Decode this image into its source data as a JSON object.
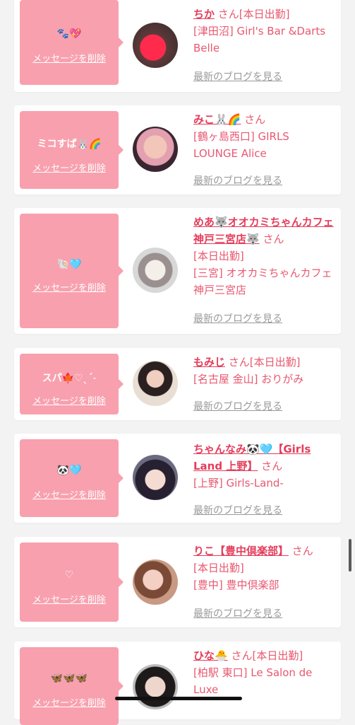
{
  "common": {
    "delete_label": "メッセージを削除",
    "blog_label": "最新のブログを見る",
    "san": "さん"
  },
  "cards": [
    {
      "msg": "🐾💖",
      "name": "ちか",
      "lines": [
        "さん[本日出勤]",
        "[津田沼] Girl's Bar &Darts Belle"
      ]
    },
    {
      "msg": "ミコすぱ🐰🌈",
      "name": "みこ🐰🌈",
      "lines": [
        "[鶴ヶ島西口] GIRLS LOUNGE Alice"
      ]
    },
    {
      "msg": "🐚🩵",
      "name": "めあ🐺オオカミちゃんカフェ神戸三宮店🐺",
      "lines": [
        "[本日出勤]",
        "[三宮] オオカミちゃんカフェ神戸三宮店"
      ]
    },
    {
      "msg": "スパ🍁♡ˎˊ˗",
      "name": "もみじ",
      "lines": [
        "さん[本日出勤]",
        "[名古屋 金山] おりがみ"
      ]
    },
    {
      "msg": "🐼🩵",
      "name": "ちゃんなみ🐼🩵【Girls Land 上野】",
      "lines": [
        "[上野] Girls-Land-"
      ]
    },
    {
      "msg": "♡",
      "name": "りこ【豊中倶楽部】",
      "lines": [
        "[本日出勤]",
        "[豊中] 豊中倶楽部"
      ]
    },
    {
      "msg": "🦋🦋🦋",
      "name": "ひな🐣",
      "lines": [
        "さん[本日出勤]",
        "[柏駅 東口] Le Salon de Luxe"
      ]
    }
  ],
  "colors": {
    "accent": "#e43d5b",
    "bubble": "#f8a0ae",
    "background": "#f3f3f3"
  }
}
